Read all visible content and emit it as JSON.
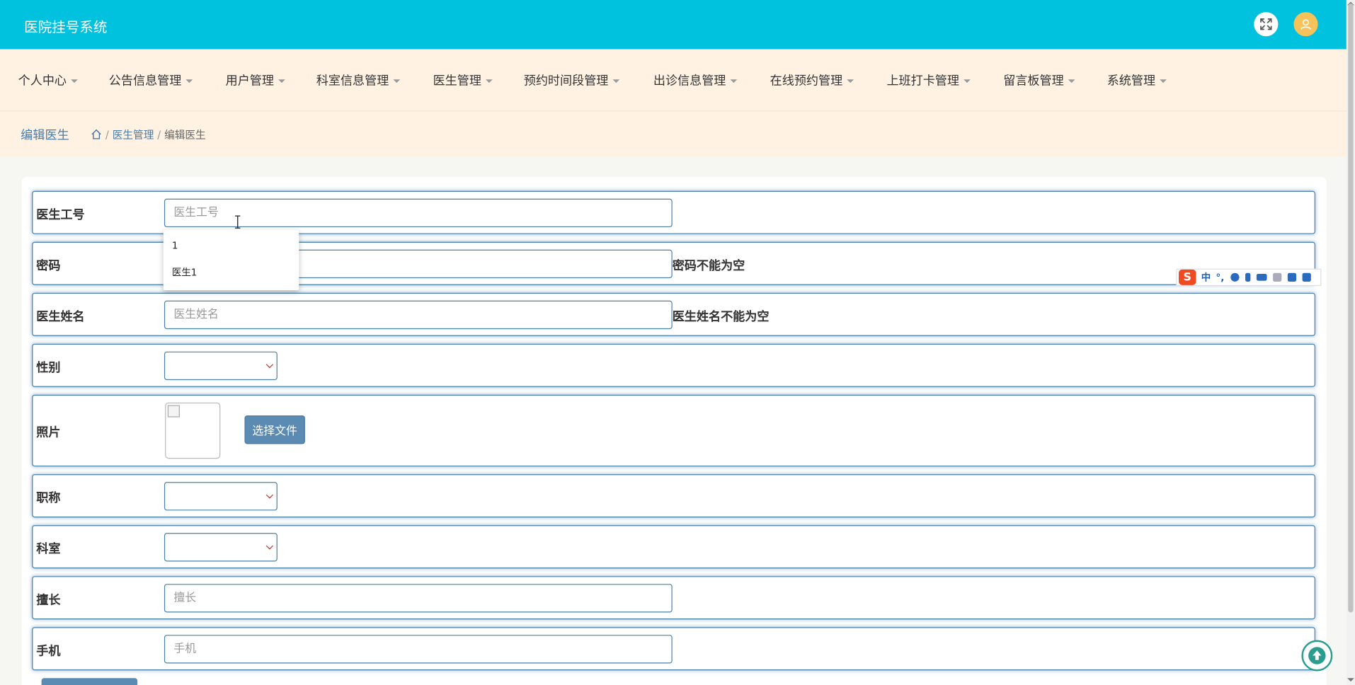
{
  "app": {
    "title": "医院挂号系统"
  },
  "header": {
    "expand_icon": "expand-icon",
    "user_icon": "user-icon"
  },
  "nav": {
    "items": [
      {
        "label": "个人中心"
      },
      {
        "label": "公告信息管理"
      },
      {
        "label": "用户管理"
      },
      {
        "label": "科室信息管理"
      },
      {
        "label": "医生管理"
      },
      {
        "label": "预约时间段管理"
      },
      {
        "label": "出诊信息管理"
      },
      {
        "label": "在线预约管理"
      },
      {
        "label": "上班打卡管理"
      },
      {
        "label": "留言板管理"
      },
      {
        "label": "系统管理"
      }
    ]
  },
  "breadcrumb": {
    "page_title": "编辑医生",
    "items": [
      "医生管理",
      "编辑医生"
    ],
    "separator": "/"
  },
  "form": {
    "doctor_id": {
      "label": "医生工号",
      "placeholder": "医生工号",
      "value": ""
    },
    "password": {
      "label": "密码",
      "placeholder": "",
      "error": "密码不能为空"
    },
    "doctor_name": {
      "label": "医生姓名",
      "placeholder": "医生姓名",
      "error": "医生姓名不能为空"
    },
    "gender": {
      "label": "性别",
      "selected": ""
    },
    "photo": {
      "label": "照片",
      "file_button": "选择文件"
    },
    "title": {
      "label": "职称",
      "selected": ""
    },
    "department": {
      "label": "科室",
      "selected": ""
    },
    "specialty": {
      "label": "擅长",
      "placeholder": "擅长"
    },
    "phone": {
      "label": "手机",
      "placeholder": "手机"
    }
  },
  "autocomplete": {
    "items": [
      "1",
      "医生1"
    ]
  },
  "ime": {
    "logo": "S",
    "mode": "中",
    "punct": "°,"
  }
}
